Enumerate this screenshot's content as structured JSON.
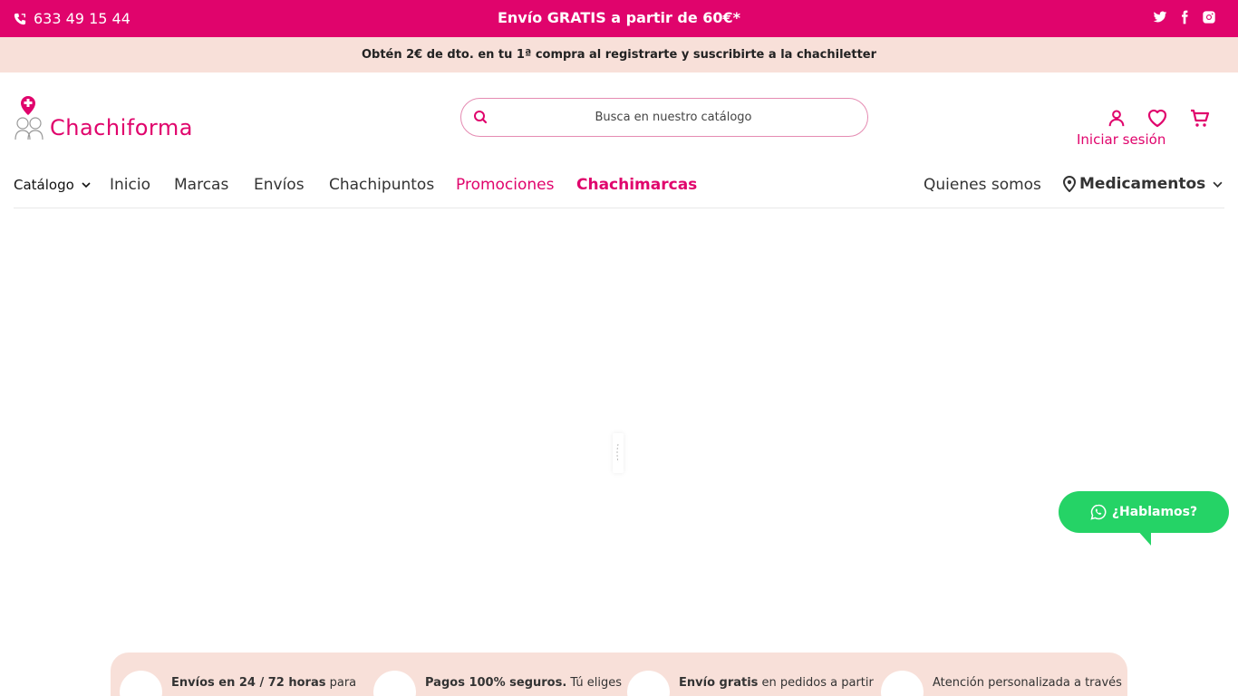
{
  "topbar": {
    "phone": "633 49 15 44",
    "shipping": "Envío GRATIS a partir de 60€*",
    "social": [
      "twitter-icon",
      "facebook-icon",
      "instagram-icon"
    ]
  },
  "promo": {
    "text": "Obtén 2€ de dto. en tu 1ª compra al registrarte y suscribirte a la chachiletter"
  },
  "header": {
    "brand": "Chachiforma",
    "search_placeholder": "Busca en nuestro catálogo",
    "login": "Iniciar sesión"
  },
  "nav": {
    "catalog": "Catálogo",
    "items": [
      "Inicio",
      "Marcas",
      "Envíos",
      "Chachipuntos",
      "Promociones",
      "Chachimarcas"
    ],
    "about": "Quienes somos",
    "medicines": "Medicamentos"
  },
  "whatsapp": {
    "label": "¿Hablamos?"
  },
  "features": [
    {
      "bold": "Envíos en 24 / 72 horas",
      "rest": " para"
    },
    {
      "bold": "Pagos 100% seguros.",
      "rest": " Tú eliges"
    },
    {
      "bold": "Envío gratis",
      "rest": " en pedidos a partir"
    },
    {
      "bold": "",
      "rest": "Atención personalizada a través"
    }
  ],
  "colors": {
    "brand": "#e0046c",
    "promo_bg": "#f8e0d9",
    "whatsapp": "#25d366"
  }
}
